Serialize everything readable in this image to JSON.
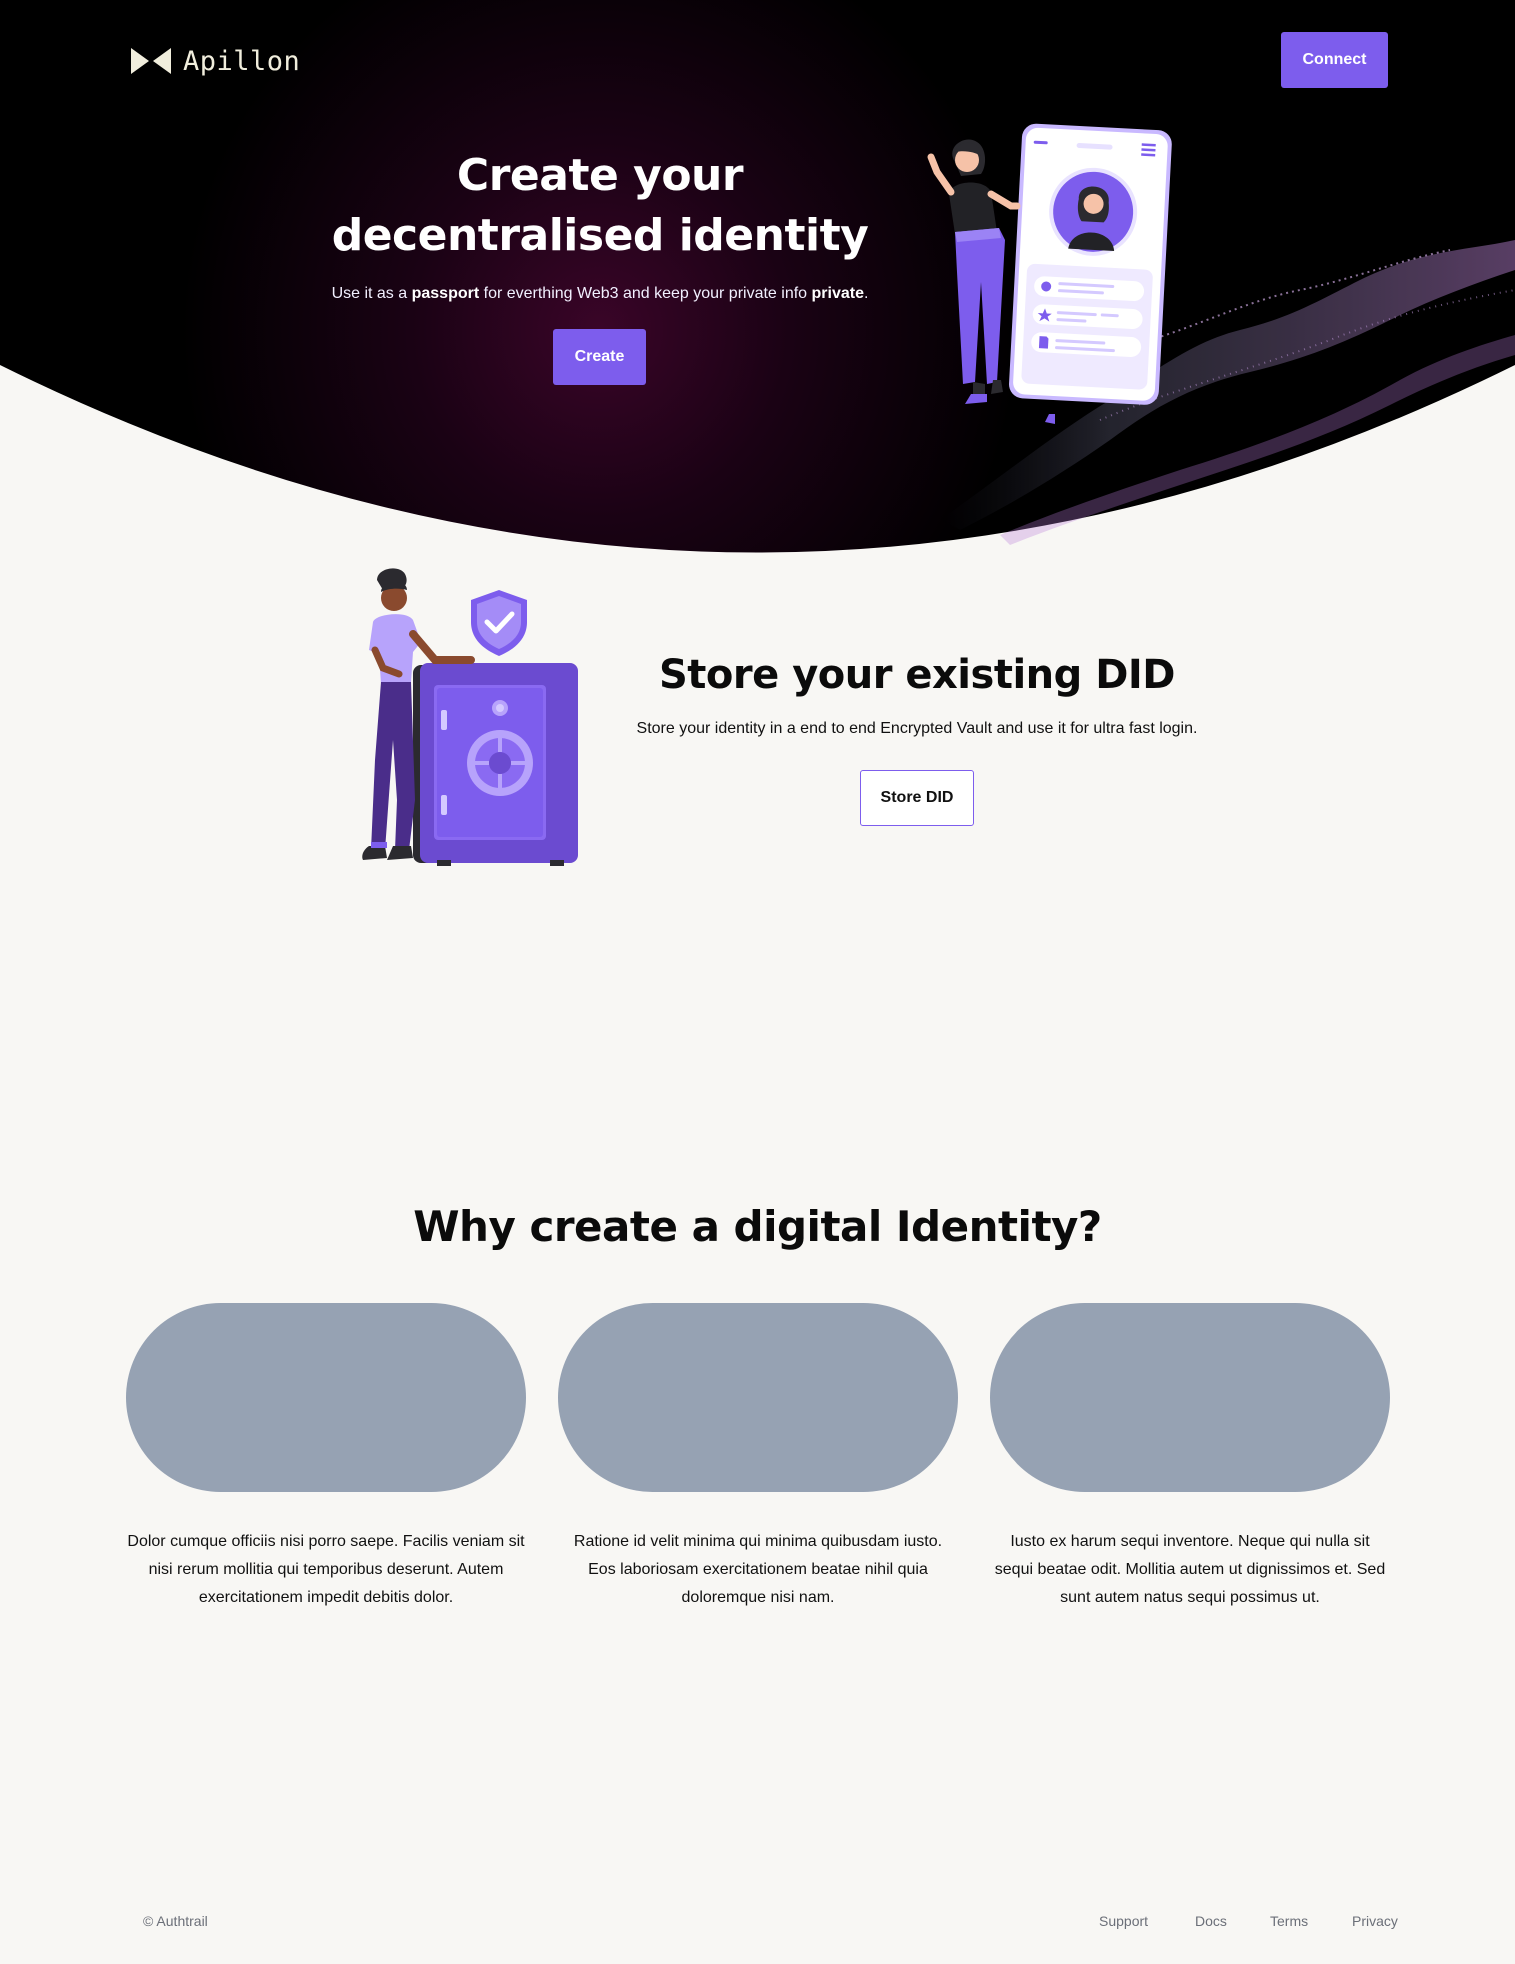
{
  "brand": {
    "name": "Apillon",
    "logo_icon": "bowtie-logo-icon"
  },
  "header": {
    "connect_label": "Connect"
  },
  "hero": {
    "title": "Create your decentralised identity",
    "subtitle_parts": [
      "Use it as a ",
      "passport",
      " for everthing Web3 and keep your private info ",
      "private",
      "."
    ],
    "create_label": "Create",
    "illustration": "woman-with-phone-profile-illustration"
  },
  "store": {
    "title": "Store your existing DID",
    "subtitle": "Store your identity in a end to end Encrypted Vault and use it for ultra fast login.",
    "button_label": "Store DID",
    "illustration": "man-with-safe-illustration"
  },
  "why": {
    "title": "Why create a digital Identity?",
    "cards": [
      {
        "text": "Dolor cumque officiis nisi porro saepe. Facilis veniam sit nisi rerum mollitia qui temporibus deserunt. Autem exercitationem impedit debitis dolor."
      },
      {
        "text": "Ratione id velit minima qui minima quibusdam iusto. Eos laboriosam exercitationem beatae nihil quia doloremque nisi nam."
      },
      {
        "text": "Iusto ex harum sequi inventore. Neque qui nulla sit sequi beatae odit. Mollitia autem ut dignissimos et. Sed sunt autem natus sequi possimus ut."
      }
    ]
  },
  "footer": {
    "copyright": "© Authtrail",
    "links": [
      "Support",
      "Docs",
      "Terms",
      "Privacy"
    ]
  },
  "colors": {
    "accent": "#7d5ded",
    "hero_bg": "#000000",
    "page_bg": "#f8f7f4",
    "card_placeholder": "#96a2b3",
    "footer_text": "#6b6f78"
  }
}
